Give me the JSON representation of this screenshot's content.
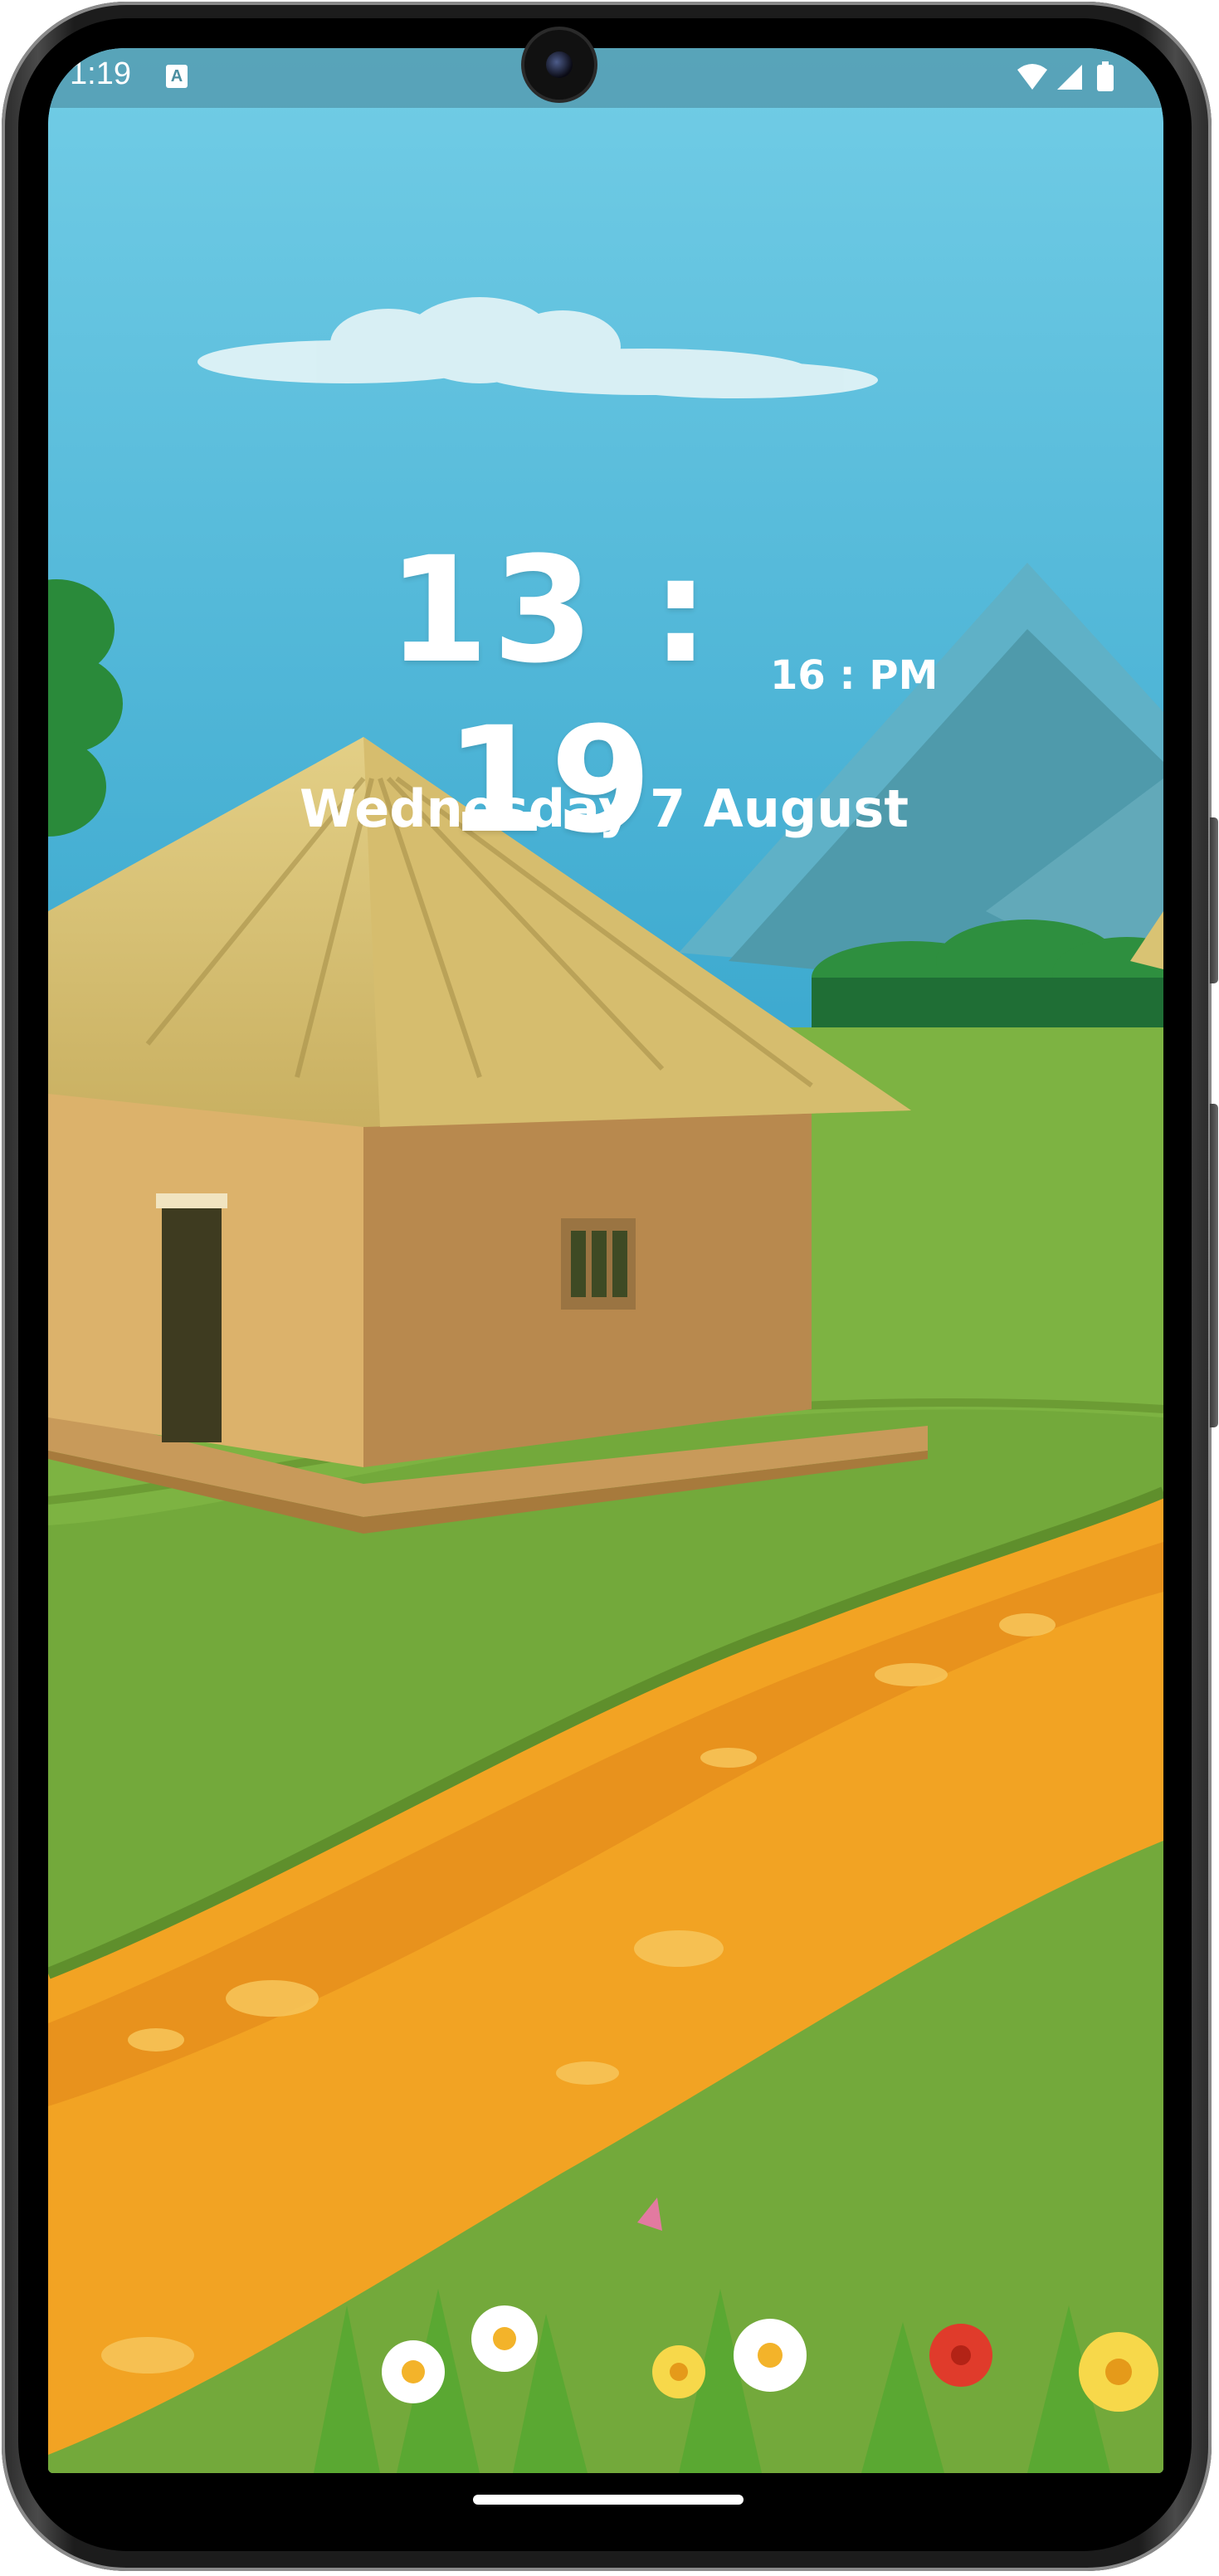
{
  "status_bar": {
    "time": "1:19",
    "notification_icon": "a-icon",
    "icons": [
      "wifi-icon",
      "signal-icon",
      "battery-icon"
    ]
  },
  "clock": {
    "time": "13 : 19",
    "suffix": "16 : PM",
    "date": "Wednesday 7 August"
  },
  "wallpaper": {
    "scene": "village-hut-landscape",
    "colors": {
      "sky_top": "#6ec9e4",
      "sky_bottom": "#3aa9cf",
      "grass": "#7db342",
      "path": "#f2a323",
      "roof": "#d9c373",
      "wall": "#b8894e"
    }
  }
}
